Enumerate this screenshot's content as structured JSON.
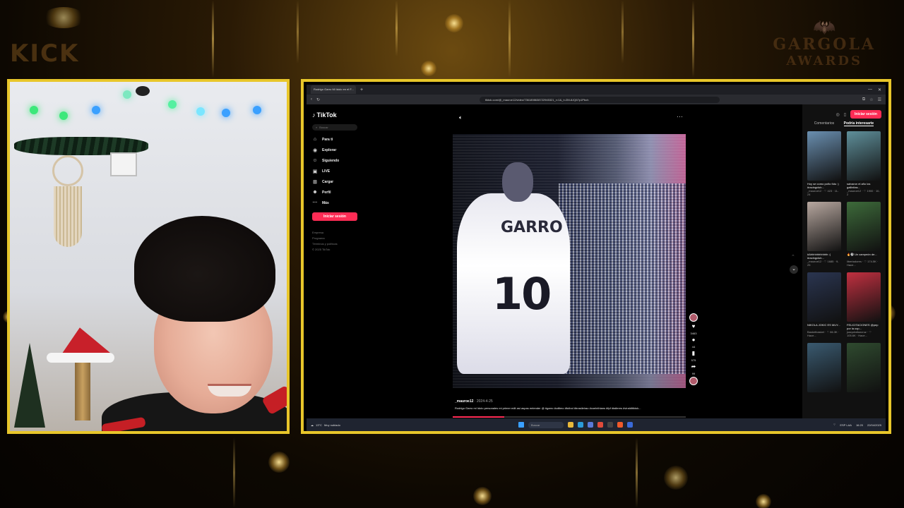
{
  "overlay": {
    "kick_brand": "KICK",
    "gargola_line1": "GARGOLA",
    "gargola_line2": "AWARDS"
  },
  "browser": {
    "tab_title": "Rodrigo Garro Mi Idolo en el F...",
    "url": "tiktok.com/@_mauroe12/video/7361898638722945321_r=1&_t=ZM-8JQ67p1Pbch"
  },
  "tiktok": {
    "logo": "TikTok",
    "search_placeholder": "Buscar",
    "nav": [
      {
        "icon": "home-icon",
        "label": "Para ti"
      },
      {
        "icon": "compass-icon",
        "label": "Explorar"
      },
      {
        "icon": "following-icon",
        "label": "Siguiendo"
      },
      {
        "icon": "live-icon",
        "label": "LIVE"
      },
      {
        "icon": "upload-icon",
        "label": "Cargar"
      },
      {
        "icon": "profile-icon",
        "label": "Perfil"
      },
      {
        "icon": "more-icon",
        "label": "Más"
      }
    ],
    "login_button": "Iniciar sesión",
    "footer": [
      "Empresa",
      "Programa",
      "Términos y políticas",
      "© 2025 TikTok"
    ],
    "video": {
      "jersey_name": "GARRO",
      "jersey_number": "10",
      "progress": 0.22
    },
    "actions": {
      "likes": "3463",
      "comments": "44",
      "saves": "575",
      "shares": "99"
    },
    "caption": {
      "user": "_mauroe12",
      "date": "· 2024-4-25",
      "text": "Rodrigo Garro mi Idolo personales mi primer edit así aspas entender @ #garro #cdtimo #futbol #brasileirao #coelnthians #fpf #talleres #viralditiktok..."
    },
    "right_panel": {
      "login_button": "Iniciar sesión",
      "tabs": [
        "Comentarios",
        "Podría interesarte"
      ],
      "thumbs": [
        {
          "title": "Hoy se como poño fútu :) #racingclub...",
          "meta": "_mauroe12 · ♡ 423 · 11-24",
          "color": "#6a8fb0"
        },
        {
          "title": "salvaron el año los gallinitas...",
          "meta": "_mauroe12 · ♡ 1900 · 10-2",
          "color": "#5f8f9a"
        },
        {
          "title": "#Ahhhhhhhhhhh :( #racingclub...",
          "meta": "_mauroe12 · ♡ 1685 · 9-25",
          "color": "#b8a8a0"
        },
        {
          "title": "🔥⚽ Un campeón de...",
          "meta": "libertadores · ♡ 174.5K · Hace...",
          "color": "#3d6a3a"
        },
        {
          "title": "NIKOLA JOKIC ES MUY...",
          "meta": "Basketbasket · ♡ 86.3K · Hace...",
          "color": "#2a3550"
        },
        {
          "title": "FELICITACIONES @pep por la cop...",
          "meta": "juaquindiazcruz · ♡ 105.6K · Hace...",
          "color": "#c03040"
        },
        {
          "title": "",
          "meta": "",
          "color": "#3a5a70"
        },
        {
          "title": "",
          "meta": "",
          "color": "#2f4a2f"
        }
      ]
    }
  },
  "taskbar": {
    "weather": "13°C",
    "weather_desc": "Muy nublado",
    "search": "Buscar",
    "lang": "ESP LAA",
    "time": "16:20",
    "date": "22/04/2025"
  }
}
